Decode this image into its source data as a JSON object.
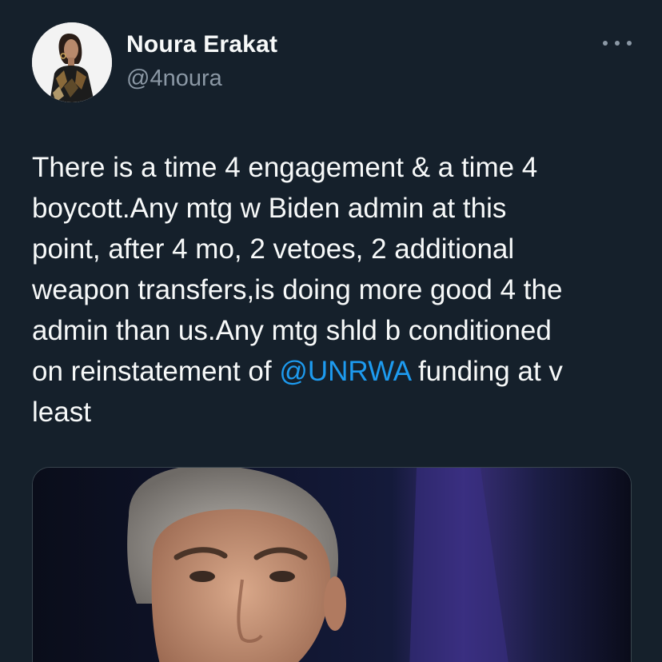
{
  "author": {
    "display_name": "Noura Erakat",
    "handle": "@4noura",
    "avatar_icon": "profile-photo"
  },
  "more_icon": "more-horizontal-icon",
  "tweet": {
    "text_before": "There is a time 4 engagement & a time 4\nboycott.Any mtg w Biden admin at this\npoint, after 4 mo, 2 vetoes, 2 additional\nweapon transfers,is doing more good 4 the\nadmin than us.Any mtg shld b conditioned\non reinstatement of ",
    "mention": "@UNRWA",
    "text_after": " funding at v\nleast"
  },
  "colors": {
    "background": "#15202b",
    "text": "#f7f9f9",
    "secondary": "#8b98a5",
    "accent": "#1d9bf0"
  }
}
